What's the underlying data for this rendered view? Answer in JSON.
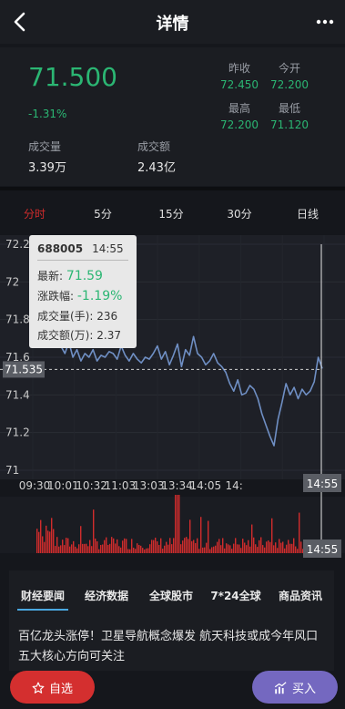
{
  "header": {
    "title": "详情",
    "back_icon": "chevron-left-icon",
    "more_icon": "more-dots-icon"
  },
  "quote": {
    "price": "71.500",
    "change_pct": "-1.31%",
    "prev_close_label": "昨收",
    "prev_close": "72.450",
    "open_label": "今开",
    "open": "72.200",
    "high_label": "最高",
    "high": "72.200",
    "low_label": "最低",
    "low": "71.120",
    "volume_label": "成交量",
    "volume": "3.39万",
    "amount_label": "成交额",
    "amount": "2.43亿",
    "colors": {
      "up": "#2bb673",
      "down_red": "#d12c2c"
    }
  },
  "tabs": [
    "分时",
    "5分",
    "15分",
    "30分",
    "日线"
  ],
  "active_tab": 0,
  "tooltip": {
    "code": "688005",
    "time": "14:55",
    "latest_label": "最新:",
    "latest": "71.59",
    "change_label": "涨跌幅:",
    "change": "-1.19%",
    "volume_label": "成交量(手):",
    "volume": "236",
    "amount_label": "成交额(万):",
    "amount": "2.37"
  },
  "chart_data": {
    "type": "line",
    "y_ticks": [
      "72.2",
      "72",
      "71.8",
      "71.6",
      "71.4",
      "71.2",
      "71"
    ],
    "ylim": [
      71.0,
      72.2
    ],
    "x_ticks": [
      "09:30",
      "10:01",
      "10:32",
      "11:03",
      "13:03",
      "13:34",
      "14:05",
      "14:"
    ],
    "crosshair_price": "71.535",
    "crosshair_time": "14:55",
    "volume_time": "14:55",
    "series": [
      {
        "values": [
          71.7,
          71.72,
          71.66,
          71.62,
          71.68,
          71.6,
          71.64,
          71.58,
          71.62,
          71.6,
          71.64,
          71.58,
          71.61,
          71.6,
          71.63,
          71.62,
          71.59,
          71.66,
          71.61,
          71.58,
          71.62,
          71.59,
          71.57,
          71.6,
          71.59,
          71.62,
          71.66,
          71.59,
          71.63,
          71.56,
          71.61,
          71.67,
          71.55,
          71.64,
          71.61,
          71.71,
          71.62,
          71.6,
          71.56,
          71.58,
          71.62,
          71.57,
          71.55,
          71.52,
          71.46,
          71.42,
          71.48,
          71.4,
          71.41,
          71.45,
          71.43,
          71.38,
          71.3,
          71.24,
          71.18,
          71.13,
          71.27,
          71.36,
          71.46,
          71.4,
          71.44,
          71.38,
          71.43,
          71.4,
          71.42,
          71.47,
          71.6,
          71.54
        ]
      }
    ],
    "volume_color": "#d12c2c",
    "line_color": "#6f8fc4"
  },
  "news": {
    "tabs": [
      "财经要闻",
      "经济数据",
      "全球股市",
      "7*24全球",
      "商品资讯"
    ],
    "active_tab": 0,
    "headline": "百亿龙头涨停！卫星导航概念爆发 航天科技或成今年风口 五大核心方向可关注"
  },
  "actions": {
    "watch_label": "自选",
    "buy_label": "买入",
    "watch_icon": "star-icon",
    "buy_icon": "chart-icon"
  }
}
